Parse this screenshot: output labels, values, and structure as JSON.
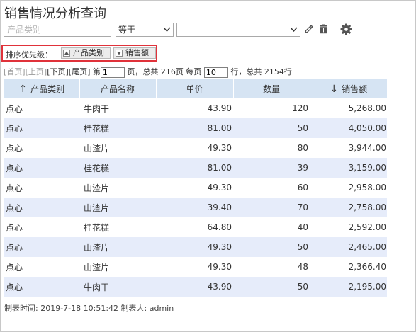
{
  "title": "销售情况分析查询",
  "filter": {
    "field_placeholder": "产品类别",
    "operator": "等于",
    "value": ""
  },
  "toolbar": {
    "edit_icon": "pencil-icon",
    "delete_icon": "trash-icon",
    "settings_icon": "gear-icon"
  },
  "sort": {
    "label": "排序优先级：",
    "items": [
      {
        "label": "产品类别",
        "direction": "up"
      },
      {
        "label": "销售额",
        "direction": "down"
      }
    ]
  },
  "pager": {
    "first": "[首页]",
    "prev": "[上页]",
    "next": "[下页]",
    "last": "[尾页]",
    "page_prefix": "第",
    "page_value": "1",
    "page_suffix": "页，总共 216页 每页",
    "per_page_value": "10",
    "rows_suffix": "行，总共 2154行"
  },
  "table": {
    "headers": [
      {
        "label": "产品类别",
        "sort_arrow": "↑"
      },
      {
        "label": "产品名称",
        "sort_arrow": ""
      },
      {
        "label": "单价",
        "sort_arrow": ""
      },
      {
        "label": "数量",
        "sort_arrow": ""
      },
      {
        "label": "销售额",
        "sort_arrow": "↓"
      }
    ],
    "rows": [
      [
        "点心",
        "牛肉干",
        "43.90",
        "120",
        "5,268.00"
      ],
      [
        "点心",
        "桂花糕",
        "81.00",
        "50",
        "4,050.00"
      ],
      [
        "点心",
        "山渣片",
        "49.30",
        "80",
        "3,944.00"
      ],
      [
        "点心",
        "桂花糕",
        "81.00",
        "39",
        "3,159.00"
      ],
      [
        "点心",
        "山渣片",
        "49.30",
        "60",
        "2,958.00"
      ],
      [
        "点心",
        "山渣片",
        "39.40",
        "70",
        "2,758.00"
      ],
      [
        "点心",
        "桂花糕",
        "64.80",
        "40",
        "2,592.00"
      ],
      [
        "点心",
        "山渣片",
        "49.30",
        "50",
        "2,465.00"
      ],
      [
        "点心",
        "山渣片",
        "49.30",
        "48",
        "2,366.40"
      ],
      [
        "点心",
        "牛肉干",
        "43.90",
        "50",
        "2,195.00"
      ]
    ]
  },
  "footer": "制表时间: 2019-7-18 10:51:42 制表人: admin",
  "colors": {
    "header_bg": "#d6e4f3",
    "row_alt_bg": "#e6ecfa",
    "highlight_border": "#e0323a"
  }
}
